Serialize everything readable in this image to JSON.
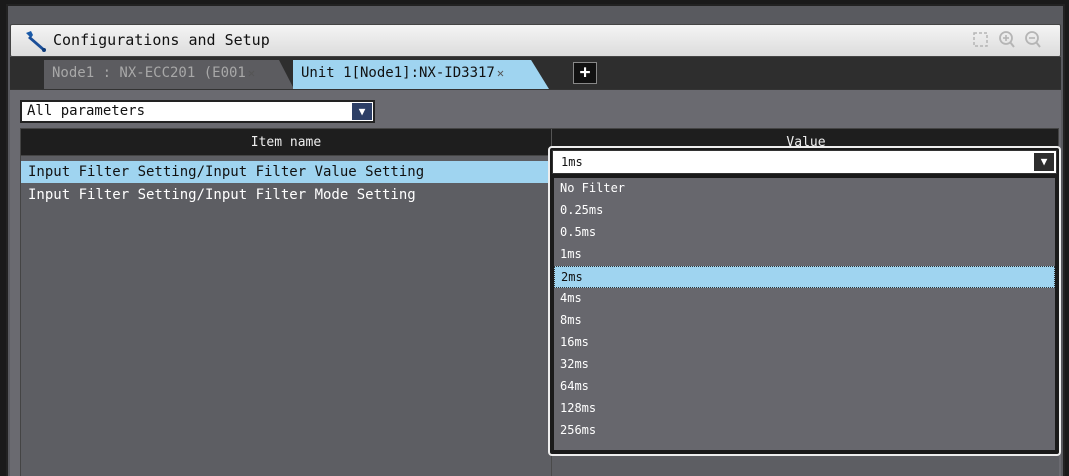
{
  "window": {
    "title": "Configurations and Setup",
    "icon": "wrench-icon"
  },
  "tabs": [
    {
      "label": "Node1 : NX-ECC201 (E001",
      "active": false
    },
    {
      "label": "Unit 1[Node1]:NX-ID3317",
      "active": true
    }
  ],
  "toolbar": {
    "add_tab_label": "+",
    "tools": [
      "fit-icon",
      "zoom-in-icon",
      "zoom-out-icon"
    ]
  },
  "filter": {
    "selected": "All parameters"
  },
  "table": {
    "columns": [
      "Item name",
      "Value"
    ],
    "rows": [
      {
        "name": "Input Filter Setting/Input Filter Value Setting",
        "selected": true
      },
      {
        "name": "Input Filter Setting/Input Filter Mode Setting",
        "selected": false
      }
    ]
  },
  "dropdown": {
    "current_value": "1ms",
    "options": [
      "No Filter",
      "0.25ms",
      "0.5ms",
      "1ms",
      "2ms",
      "4ms",
      "8ms",
      "16ms",
      "32ms",
      "64ms",
      "128ms",
      "256ms"
    ],
    "highlighted": "2ms"
  },
  "colors": {
    "selection": "#9fd4f0",
    "panel": "#6a6a70"
  }
}
